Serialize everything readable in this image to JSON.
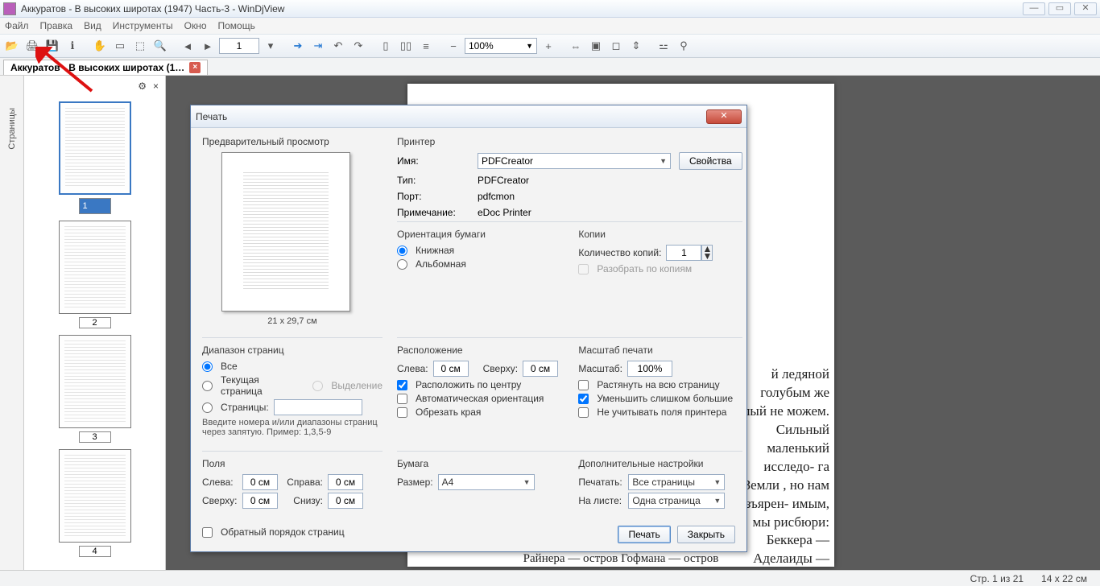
{
  "window": {
    "title": "Аккуратов - В высоких широтах (1947) Часть-3 - WinDjView"
  },
  "menu": [
    "Файл",
    "Правка",
    "Вид",
    "Инструменты",
    "Окно",
    "Помощь"
  ],
  "toolbar": {
    "page": "1",
    "zoom": "100%"
  },
  "tabs": [
    {
      "label": "Аккуратов - В высоких широтах (1…"
    }
  ],
  "sidebar": {
    "label": "Страницы",
    "gear": "⚙",
    "close": "×"
  },
  "thumbs": [
    {
      "n": "1",
      "sel": true
    },
    {
      "n": "2",
      "sel": false
    },
    {
      "n": "3",
      "sel": false
    },
    {
      "n": "4",
      "sel": false
    }
  ],
  "snippet1": "й ледяной голубым же целый не можем. Сильный маленький исследо- га Земли , но нам разъярен- имым, мы рисбюри: Беккера — Аделаиды —",
  "snippet2": "Итальянский    пролив — остров    Грили — остров\nРайнера — остров    Гофмана — остров",
  "status": {
    "page": "Стр. 1 из 21",
    "dims": "14 x 22 см"
  },
  "dialog": {
    "title": "Печать",
    "preview": {
      "h": "Предварительный просмотр",
      "caption": "21 x 29,7 см"
    },
    "printer": {
      "h": "Принтер",
      "name_l": "Имя:",
      "name_v": "PDFCreator",
      "props": "Свойства",
      "type_l": "Тип:",
      "type_v": "PDFCreator",
      "port_l": "Порт:",
      "port_v": "pdfcmon",
      "note_l": "Примечание:",
      "note_v": "eDoc Printer"
    },
    "orient": {
      "h": "Ориентация бумаги",
      "portrait": "Книжная",
      "landscape": "Альбомная"
    },
    "copies": {
      "h": "Копии",
      "count_l": "Количество копий:",
      "count_v": "1",
      "collate": "Разобрать по копиям"
    },
    "range": {
      "h": "Диапазон страниц",
      "all": "Все",
      "current": "Текущая страница",
      "selection": "Выделение",
      "pages": "Страницы:",
      "hint": "Введите номера и/или диапазоны страниц через запятую. Пример: 1,3,5-9"
    },
    "layout": {
      "h": "Расположение",
      "left_l": "Слева:",
      "left_v": "0 см",
      "top_l": "Сверху:",
      "top_v": "0 см",
      "center": "Расположить по центру",
      "autoorient": "Автоматическая ориентация",
      "crop": "Обрезать края"
    },
    "scale": {
      "h": "Масштаб печати",
      "scale_l": "Масштаб:",
      "scale_v": "100%",
      "stretch": "Растянуть на всю страницу",
      "shrink": "Уменьшить слишком большие",
      "ignore": "Не учитывать поля принтера"
    },
    "margins": {
      "h": "Поля",
      "left_l": "Слева:",
      "left_v": "0 см",
      "right_l": "Справа:",
      "right_v": "0 см",
      "top_l": "Сверху:",
      "top_v": "0 см",
      "bottom_l": "Снизу:",
      "bottom_v": "0 см"
    },
    "paper": {
      "h": "Бумага",
      "size_l": "Размер:",
      "size_v": "A4"
    },
    "extra": {
      "h": "Дополнительные настройки",
      "print_l": "Печатать:",
      "print_v": "Все страницы",
      "sheet_l": "На листе:",
      "sheet_v": "Одна страница"
    },
    "reverse": "Обратный порядок страниц",
    "ok": "Печать",
    "cancel": "Закрыть"
  }
}
